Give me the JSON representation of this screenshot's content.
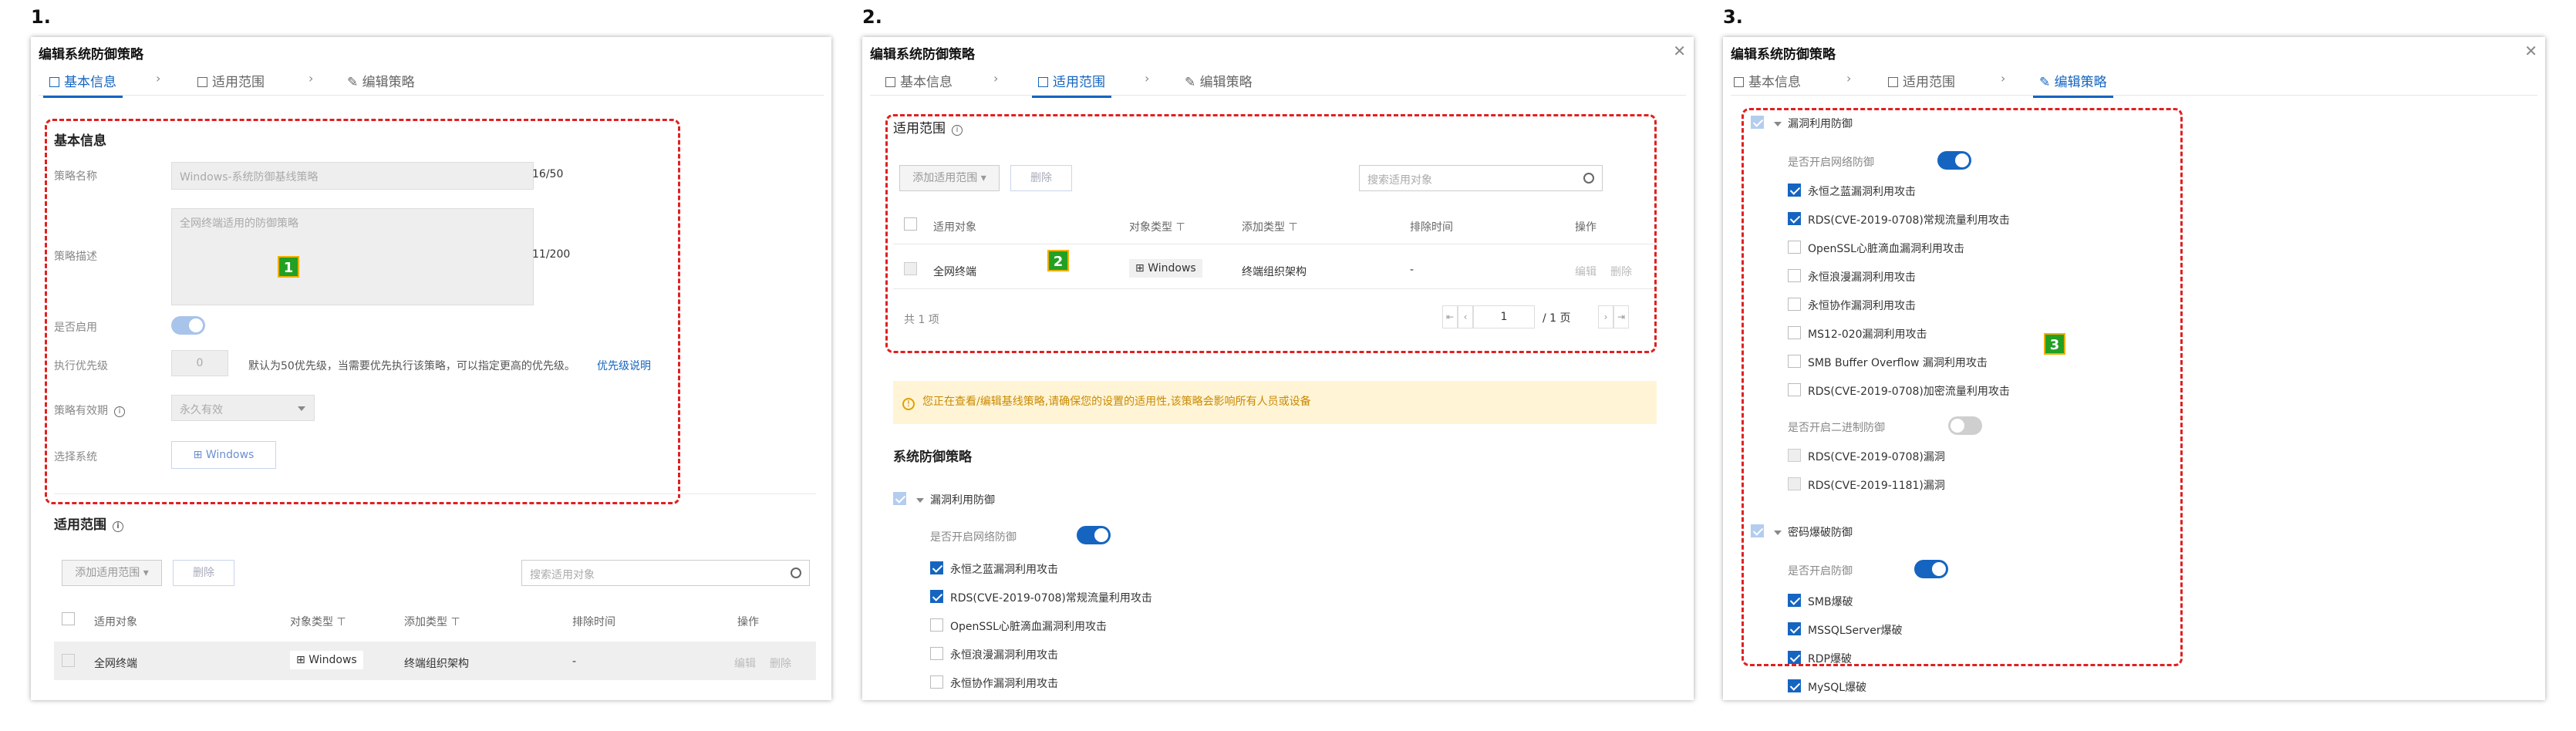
{
  "steps": [
    "1.",
    "2.",
    "3."
  ],
  "markers": [
    "1",
    "2",
    "3"
  ],
  "dialog_title": "编辑系统防御策略",
  "tabs": {
    "basic": "基本信息",
    "scope": "适用范围",
    "policy": "编辑策略"
  },
  "panel1": {
    "section": "基本信息",
    "name_label": "策略名称",
    "name_value": "Windows-系统防御基线策略",
    "name_count": "16/50",
    "desc_label": "策略描述",
    "desc_value": "全网终端适用的防御策略",
    "desc_count": "11/200",
    "enable_label": "是否启用",
    "priority_label": "执行优先级",
    "priority_value": "0",
    "priority_hint": "默认为50优先级，当需要优先执行该策略，可以指定更高的优先级。",
    "priority_link": "优先级说明",
    "validity_label": "策略有效期",
    "validity_value": "永久有效",
    "system_label": "选择系统",
    "system_value": "Windows"
  },
  "scope": {
    "title": "适用范围",
    "add_btn": "添加适用范围",
    "delete_btn": "删除",
    "search_placeholder": "搜索适用对象",
    "headers": [
      "适用对象",
      "对象类型",
      "添加类型",
      "排除时间",
      "操作"
    ],
    "row": {
      "object": "全网终端",
      "type": "Windows",
      "add_type": "终端组织架构",
      "exclude": "-",
      "edit": "编辑",
      "del": "删除"
    },
    "total": "共 1 项",
    "page": "1",
    "page_total": "/ 1 页"
  },
  "warning": "您正在查看/编辑基线策略,请确保您的设置的适用性,该策略会影响所有人员或设备",
  "policy": {
    "section": "系统防御策略",
    "group1": "漏洞利用防御",
    "net_label": "是否开启网络防御",
    "net_items": [
      "永恒之蓝漏洞利用攻击",
      "RDS(CVE-2019-0708)常规流量利用攻击",
      "OpenSSL心脏滴血漏洞利用攻击",
      "永恒浪漫漏洞利用攻击",
      "永恒协作漏洞利用攻击",
      "MS12-020漏洞利用攻击",
      "SMB Buffer Overflow 漏洞利用攻击",
      "RDS(CVE-2019-0708)加密流量利用攻击"
    ],
    "bin_label": "是否开启二进制防御",
    "bin_items": [
      "RDS(CVE-2019-0708)漏洞",
      "RDS(CVE-2019-1181)漏洞"
    ],
    "group2": "密码爆破防御",
    "brute_label": "是否开启防御",
    "brute_items": [
      "SMB爆破",
      "MSSQLServer爆破",
      "RDP爆破",
      "MySQL爆破"
    ]
  },
  "colors": {
    "accent": "#1565c0",
    "highlight": "#e02020",
    "marker": "#22a022"
  }
}
